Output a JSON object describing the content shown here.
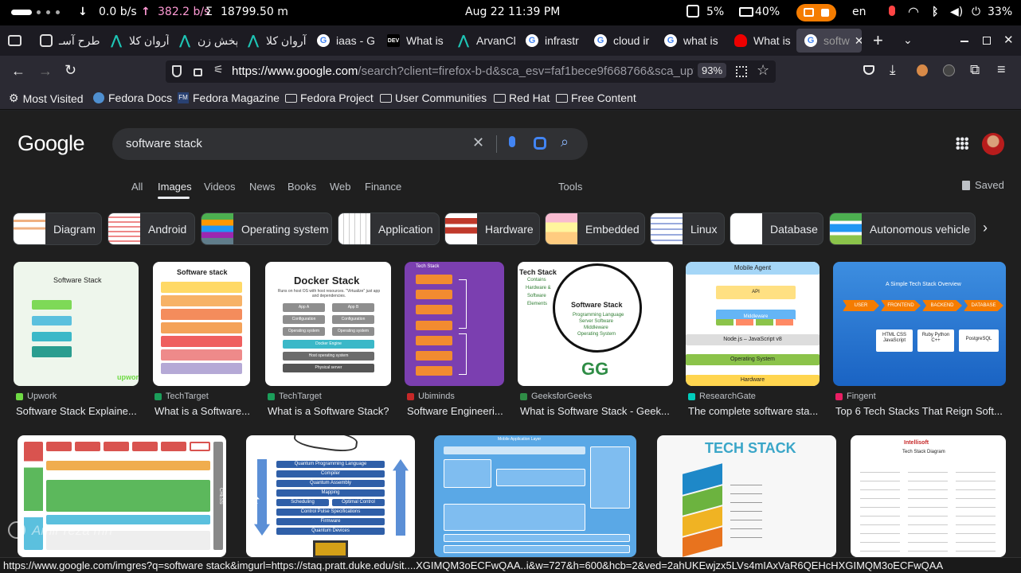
{
  "system": {
    "down_speed": "0.0 b/s",
    "up_speed": "382.2 b/s",
    "total": "18799.50 m",
    "datetime": "Aug 22  11:39 PM",
    "cpu": "5%",
    "memory": "40%",
    "language": "en",
    "battery": "33%"
  },
  "tabs": [
    {
      "label": "طرح آسـ"
    },
    {
      "label": "آروان کلا"
    },
    {
      "label": "پخش زن"
    },
    {
      "label": "آروان کلا"
    },
    {
      "label": "iaas - G"
    },
    {
      "label": "What is"
    },
    {
      "label": "ArvanCl"
    },
    {
      "label": "infrastr"
    },
    {
      "label": "cloud ir"
    },
    {
      "label": "what is"
    },
    {
      "label": "What is"
    },
    {
      "label": "softw"
    }
  ],
  "address": {
    "url_host": "https://www.google.com",
    "url_rest": "/search?client=firefox-b-d&sca_esv=faf1bece9f668766&sca_upv",
    "zoom": "93%"
  },
  "bookmarks": [
    "Most Visited",
    "Fedora Docs",
    "Fedora Magazine",
    "Fedora Project",
    "User Communities",
    "Red Hat",
    "Free Content"
  ],
  "google": {
    "logo": "Google",
    "query": "software stack",
    "nav_tabs": [
      "All",
      "Images",
      "Videos",
      "News",
      "Books",
      "Web",
      "Finance"
    ],
    "active_tab": "Images",
    "tools": "Tools",
    "saved": "Saved"
  },
  "chips": [
    "Diagram",
    "Android",
    "Operating system",
    "Application",
    "Hardware",
    "Embedded",
    "Linux",
    "Database",
    "Autonomous vehicle"
  ],
  "results_row1": [
    {
      "source": "Upwork",
      "title": "Software Stack Explaine...",
      "img_title": "Software Stack"
    },
    {
      "source": "TechTarget",
      "title": "What is a Software...",
      "img_title": "Software stack"
    },
    {
      "source": "TechTarget",
      "title": "What is a Software Stack?",
      "img_title": "Docker Stack"
    },
    {
      "source": "Ubiminds",
      "title": "Software Engineeri...",
      "img_title": "Tech Stack"
    },
    {
      "source": "GeeksforGeeks",
      "title": "What is Software Stack - Geek...",
      "img_title": "Software Stack"
    },
    {
      "source": "ResearchGate",
      "title": "The complete software sta...",
      "img_title": "Mobile Agent"
    },
    {
      "source": "Fingent",
      "title": "Top 6 Tech Stacks That Reign Soft...",
      "img_title": "A Simple Tech Stack Overview"
    }
  ],
  "row1_details": {
    "docker_sub": "Runs on host OS with host resources. \"Virtualize\" just app and dependencies.",
    "docker_layers": [
      "App A",
      "App B",
      "Configuration",
      "Configuration",
      "Operating system",
      "Operating system",
      "Docker Engine",
      "Host operating system",
      "Physical server"
    ],
    "gfg_lines": [
      "Contains",
      "Hardware &",
      "Software",
      "Elements"
    ],
    "gfg_bullets": [
      "Programming Language",
      "Server Software",
      "Middleware",
      "Operating System"
    ],
    "gfg_logo": "GG",
    "rg_labels": [
      "API",
      "Middleware",
      "Node.js – JavaScript v8",
      "Operating System",
      "Hardware"
    ],
    "fingent_steps": [
      "USER",
      "FRONTEND",
      "BACKEND",
      "DATABASE"
    ],
    "fingent_boxes": [
      "HTML CSS JavaScript",
      "Ruby Python C++",
      "PostgreSQL"
    ]
  },
  "results_row2": [
    {
      "img_title": "CHESS"
    },
    {
      "img_title": "Quantum"
    },
    {
      "img_title": "Mobile Application Layer"
    },
    {
      "img_title": "TECH STACK"
    },
    {
      "img_title": "Tech Stack Diagram",
      "brand": "Intellisoft"
    }
  ],
  "row2_details": {
    "quantum_layers": [
      "Quantum Programming Language",
      "Compiler",
      "Quantum Assembly",
      "Mapping",
      "Scheduling",
      "Optimal Control",
      "Control Pulse Specifications",
      "Firmware",
      "Quantum Devices"
    ]
  },
  "status_url": "https://www.google.com/imgres?q=software stack&imgurl=https://staq.pratt.duke.edu/sit....XGIMQM3oECFwQAA..i&w=727&h=600&hcb=2&ved=2ahUKEwjzx5LVs4mIAxVaR6QEHcHXGIMQM3oECFwQAA",
  "watermark": "Amir reza mn",
  "colors": {
    "accent": "#8ab4f8",
    "page_bg": "#1f1f1f",
    "chrome": "#2b2a33"
  }
}
